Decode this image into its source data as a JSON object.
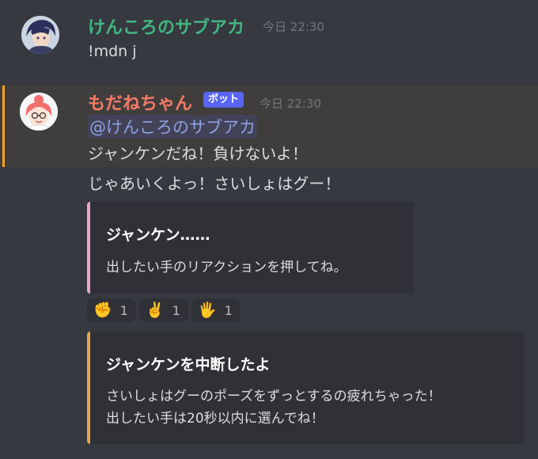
{
  "messages": [
    {
      "author": "けんころのサブアカ",
      "timestamp": "今日 22:30",
      "text": "!mdn j",
      "author_color": "#43b581"
    },
    {
      "author": "もだねちゃん",
      "bot_tag": "ボット",
      "timestamp": "今日 22:30",
      "author_color": "#f47b67",
      "mention": "@けんころのサブアカ",
      "lines": [
        "ジャンケンだね！負けないよ！",
        "じゃあいくよっ！さいしょはグー！"
      ]
    }
  ],
  "embeds": [
    {
      "title": "ジャンケン……",
      "description": "出したい手のリアクションを押してね。",
      "color": "#f0a1d3"
    },
    {
      "title": "ジャンケンを中断したよ",
      "description_lines": [
        "さいしょはグーのポーズをずっとするの疲れちゃった！",
        "出したい手は20秒以内に選んでね！"
      ],
      "color": "#f0a24e"
    }
  ],
  "reactions": [
    {
      "emoji": "✊",
      "icon": "fist-emoji-icon",
      "count": "1"
    },
    {
      "emoji": "✌️",
      "icon": "peace-hand-emoji-icon",
      "count": "1"
    },
    {
      "emoji": "🖐️",
      "icon": "open-hand-emoji-icon",
      "count": "1"
    }
  ],
  "colors": {
    "background": "#36393f",
    "mention_highlight": "#403e3c",
    "mention_bar": "#faa61a",
    "bot_tag": "#5865f2"
  }
}
